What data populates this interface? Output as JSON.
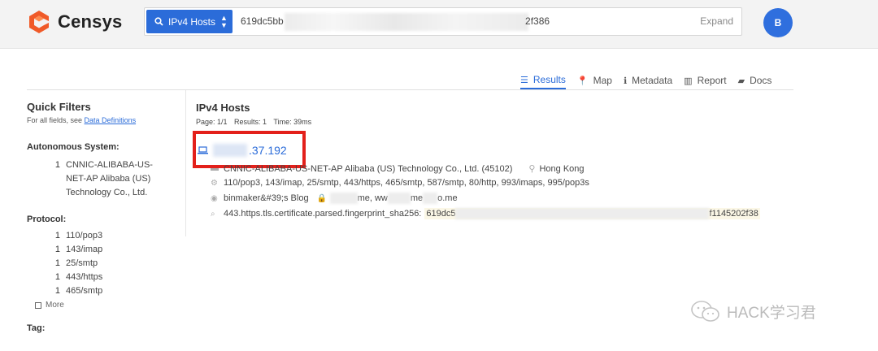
{
  "header": {
    "brand": "Censys",
    "search_type": "IPv4 Hosts",
    "search_value_prefix": "619dc5bb",
    "search_value_suffix": "f386",
    "search_value_suffix_full": "202f386",
    "expand_label": "Expand",
    "avatar_initial": "B"
  },
  "tabs": [
    {
      "label": "Results",
      "icon": "list-icon",
      "active": true
    },
    {
      "label": "Map",
      "icon": "map-pin-icon"
    },
    {
      "label": "Metadata",
      "icon": "info-icon"
    },
    {
      "label": "Report",
      "icon": "bar-chart-icon"
    },
    {
      "label": "Docs",
      "icon": "book-icon"
    }
  ],
  "sidebar": {
    "title": "Quick Filters",
    "subtitle_prefix": "For all fields, see",
    "subtitle_link": "Data Definitions",
    "sections": {
      "autonomous_system": {
        "title": "Autonomous System:",
        "items": [
          {
            "count": "1",
            "label": "CNNIC-ALIBABA-US-NET-AP Alibaba (US) Technology Co., Ltd."
          }
        ]
      },
      "protocol": {
        "title": "Protocol:",
        "items": [
          {
            "count": "1",
            "label": "110/pop3"
          },
          {
            "count": "1",
            "label": "143/imap"
          },
          {
            "count": "1",
            "label": "25/smtp"
          },
          {
            "count": "1",
            "label": "443/https"
          },
          {
            "count": "1",
            "label": "465/smtp"
          }
        ],
        "more_label": "More"
      },
      "tag": {
        "title": "Tag:"
      }
    }
  },
  "results": {
    "title": "IPv4 Hosts",
    "page": "Page: 1/1",
    "count": "Results: 1",
    "time": "Time: 39ms",
    "host": {
      "ip_visible": ".37.192",
      "as_name": "CNNIC-ALIBABA-US-NET-AP Alibaba (US) Technology Co., Ltd. (45102)",
      "location": "Hong Kong",
      "protocols": "110/pop3, 143/imap, 25/smtp, 443/https, 465/smtp, 587/smtp, 80/http, 993/imaps, 995/pop3s",
      "site_title": "binmaker&#39;s Blog",
      "names_part1": "me, ww",
      "names_part2": "me",
      "names_part3": "o.me",
      "match_field": "443.https.tls.certificate.parsed.fingerprint_sha256:",
      "fingerprint_prefix": "619dc5",
      "fingerprint_suffix": "f1145202f38"
    }
  },
  "watermark": {
    "text": "HACK学习君"
  },
  "colors": {
    "accent": "#2b6cd9",
    "highlight": "#e3201b",
    "brand_orange": "#f05a28"
  }
}
